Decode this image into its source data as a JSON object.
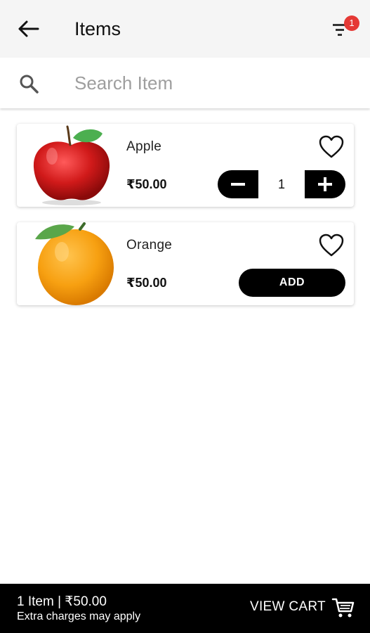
{
  "appbar": {
    "title": "Items",
    "back_icon": "arrow-left-icon",
    "filter_icon": "filter-list-icon",
    "filter_badge": "1",
    "badge_color": "#e53935"
  },
  "search": {
    "placeholder": "Search Item",
    "icon": "search-icon"
  },
  "items": [
    {
      "name": "Apple",
      "price": "₹50.00",
      "image": "red-apple-image",
      "favorite_icon": "heart-outline-icon",
      "quantity": "1",
      "in_cart": true
    },
    {
      "name": "Orange",
      "price": "₹50.00",
      "image": "orange-fruit-image",
      "favorite_icon": "heart-outline-icon",
      "add_label": "ADD",
      "in_cart": false
    }
  ],
  "cart_bar": {
    "summary": "1 Item | ₹50.00",
    "note": "Extra charges may apply",
    "view_cart_label": "VIEW CART",
    "cart_icon": "shopping-cart-icon"
  },
  "colors": {
    "appbar_bg": "#f5f5f5",
    "accent": "#000000",
    "background": "#ffffff"
  }
}
